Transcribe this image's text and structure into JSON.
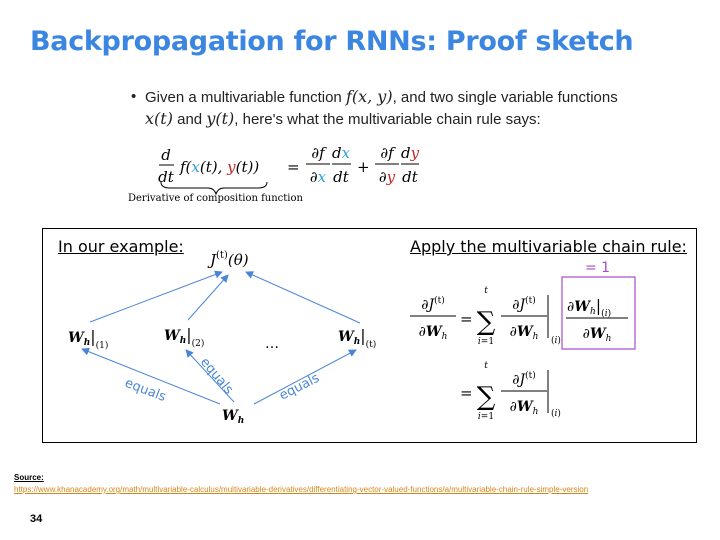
{
  "slide": {
    "title": "Backpropagation for RNNs: Proof sketch",
    "bullet_line1_a": "Given a multivariable function ",
    "bullet_line1_b": ", and two single variable functions",
    "bullet_line2_a": " and ",
    "bullet_line2_b": ", here's what the multivariable chain rule says:",
    "fxy": "f(x, y)",
    "xt": "x(t)",
    "yt": "y(t)",
    "brace_caption": "Derivative of composition function",
    "example_label": "In our example:",
    "apply_label": "Apply the multivariable chain rule:",
    "equals_one": "= 1",
    "ellipsis": "…",
    "equals_label": "equals",
    "source_label": "Source:",
    "source_url": "https://www.khanacademy.org/math/multivariable-calculus/multivariable-derivatives/differentiating-vector-valued-functions/a/multivariable-chain-rule-simple-version",
    "page_number": "34"
  },
  "colors": {
    "title": "#3b86e0",
    "arrow": "#4a86d6",
    "x_var": "#2f9fd6",
    "y_var": "#c62828",
    "highlight_box": "#a64cc6",
    "source_url": "#d6871b"
  }
}
